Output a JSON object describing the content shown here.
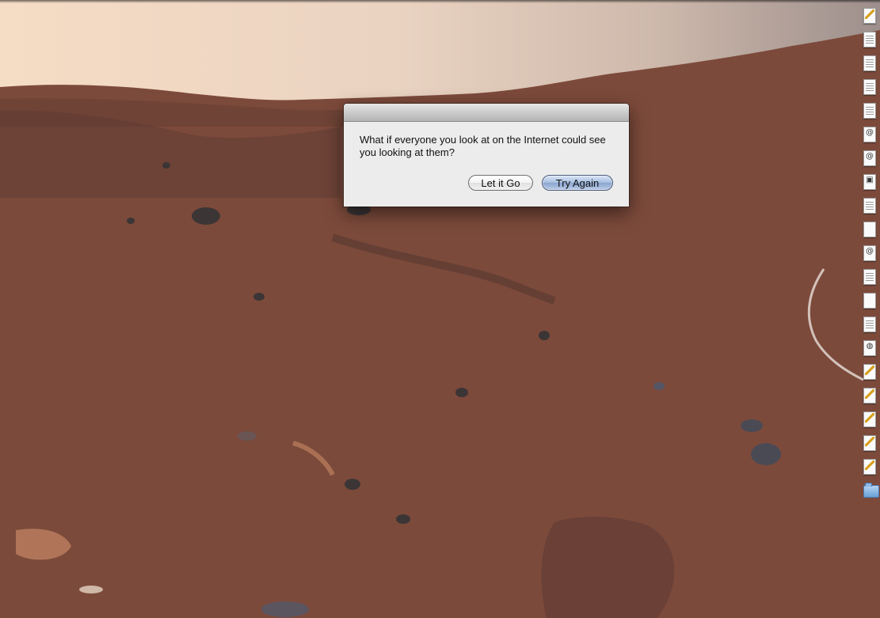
{
  "dialog": {
    "message": "What if everyone you look at on the Internet could see you looking at them?",
    "buttons": {
      "let_go_label": "Let it Go",
      "try_again_label": "Try Again"
    }
  },
  "desktop": {
    "wallpaper": "mars-landscape",
    "icons": [
      {
        "name": "script-document-icon",
        "glyph": ""
      },
      {
        "name": "text-document-icon",
        "glyph": ""
      },
      {
        "name": "text-document-icon",
        "glyph": ""
      },
      {
        "name": "text-document-icon",
        "glyph": ""
      },
      {
        "name": "text-document-icon",
        "glyph": ""
      },
      {
        "name": "internet-location-icon",
        "glyph": "@"
      },
      {
        "name": "internet-location-icon",
        "glyph": "@"
      },
      {
        "name": "image-document-icon",
        "glyph": "▣"
      },
      {
        "name": "text-document-icon",
        "glyph": ""
      },
      {
        "name": "blank-document-icon",
        "glyph": ""
      },
      {
        "name": "internet-location-icon",
        "glyph": "@"
      },
      {
        "name": "text-document-icon",
        "glyph": ""
      },
      {
        "name": "blank-document-icon",
        "glyph": ""
      },
      {
        "name": "text-document-icon",
        "glyph": ""
      },
      {
        "name": "web-location-icon",
        "glyph": "◍"
      },
      {
        "name": "script-document-icon",
        "glyph": ""
      },
      {
        "name": "script-document-icon",
        "glyph": ""
      },
      {
        "name": "script-document-icon",
        "glyph": ""
      },
      {
        "name": "script-document-icon",
        "glyph": ""
      },
      {
        "name": "script-document-icon",
        "glyph": ""
      },
      {
        "name": "folder-icon",
        "glyph": ""
      }
    ]
  },
  "colors": {
    "dialog_bg": "#ececec",
    "default_button": "#a9bfe0"
  }
}
